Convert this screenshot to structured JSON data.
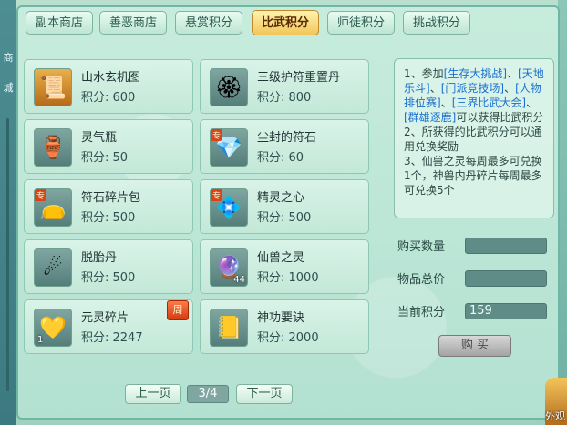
{
  "left_strip": {
    "chars": [
      "商",
      "城"
    ]
  },
  "tabs": [
    {
      "label": "副本商店",
      "active": false
    },
    {
      "label": "善恶商店",
      "active": false
    },
    {
      "label": "悬赏积分",
      "active": false
    },
    {
      "label": "比武积分",
      "active": true
    },
    {
      "label": "师徒积分",
      "active": false
    },
    {
      "label": "挑战积分",
      "active": false
    }
  ],
  "items": [
    {
      "name": "山水玄机图",
      "price": "积分: 600",
      "icon": "scroll-painting-icon",
      "glyph": "📜",
      "qty": "",
      "badge": ""
    },
    {
      "name": "三级护符重置丹",
      "price": "积分: 800",
      "icon": "gold-talisman-pill-icon",
      "glyph": "🏵",
      "qty": "",
      "badge": ""
    },
    {
      "name": "灵气瓶",
      "price": "积分: 50",
      "icon": "spirit-vase-icon",
      "glyph": "🏺",
      "qty": "",
      "badge": ""
    },
    {
      "name": "尘封的符石",
      "price": "积分: 60",
      "icon": "sealed-rune-stone-icon",
      "glyph": "💎",
      "qty": "",
      "badge": "专"
    },
    {
      "name": "符石碎片包",
      "price": "积分: 500",
      "icon": "rune-fragment-bag-icon",
      "glyph": "👝",
      "qty": "",
      "badge": "专"
    },
    {
      "name": "精灵之心",
      "price": "积分: 500",
      "icon": "spirit-heart-icon",
      "glyph": "💠",
      "qty": "",
      "badge": "专"
    },
    {
      "name": "脱胎丹",
      "price": "积分: 500",
      "icon": "rebirth-pill-icon",
      "glyph": "☄",
      "qty": "",
      "badge": ""
    },
    {
      "name": "仙兽之灵",
      "price": "积分: 1000",
      "icon": "immortal-beast-spirit-icon",
      "glyph": "🔮",
      "qty": "44",
      "badge": ""
    },
    {
      "name": "元灵碎片",
      "price": "积分: 2247",
      "icon": "yuanling-shard-icon",
      "glyph": "💛",
      "qty": "1",
      "badge": ""
    },
    {
      "name": "神功要诀",
      "price": "积分: 2000",
      "icon": "skill-manual-icon",
      "glyph": "📒",
      "qty": "",
      "badge": ""
    }
  ],
  "weekly_badge": "周",
  "info": {
    "l1_pre": "1、参加",
    "l1_a": "[生存大挑战]",
    "l1_sep1": "、",
    "l1_b": "[天地乐斗]",
    "l1_sep2": "、",
    "l1_c": "[门派竞技场]",
    "l1_sep3": "、",
    "l1_d": "[人物排位赛]",
    "l1_sep4": "、",
    "l1_e": "[三界比武大会]",
    "l1_sep5": "、",
    "l1_f": "[群雄逐鹿]",
    "l1_post": "可以获得比武积分",
    "l2": "2、所获得的比武积分可以通用兑换奖励",
    "l3": "3、仙兽之灵每周最多可兑换1个，神兽内丹碎片每周最多可兑换5个"
  },
  "form": {
    "qty_label": "购买数量",
    "qty_value": "",
    "total_label": "物品总价",
    "total_value": "",
    "points_label": "当前积分",
    "points_value": "159",
    "buy_label": "购 买"
  },
  "pager": {
    "prev": "上一页",
    "page": "3/4",
    "next": "下一页"
  },
  "corner_text": "外观"
}
